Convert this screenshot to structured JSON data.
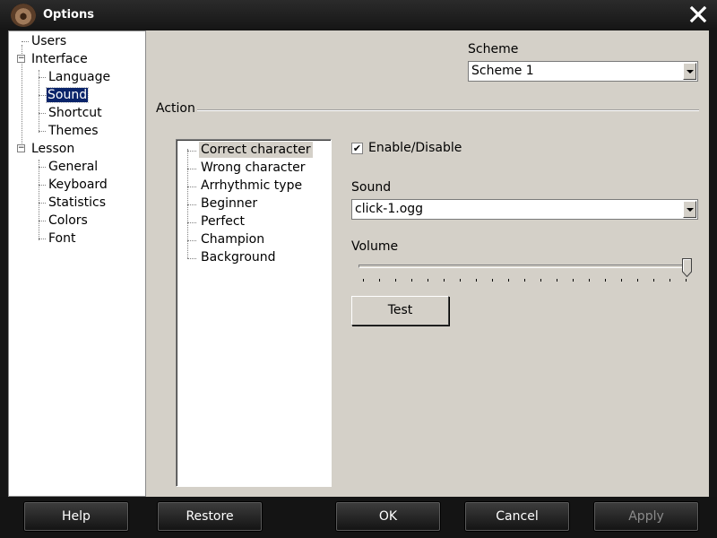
{
  "window": {
    "title": "Options"
  },
  "tree": [
    {
      "label": "Users"
    },
    {
      "label": "Interface"
    },
    {
      "label": "Language"
    },
    {
      "label": "Sound",
      "selected": true
    },
    {
      "label": "Shortcut"
    },
    {
      "label": "Themes"
    },
    {
      "label": "Lesson"
    },
    {
      "label": "General"
    },
    {
      "label": "Keyboard"
    },
    {
      "label": "Statistics"
    },
    {
      "label": "Colors"
    },
    {
      "label": "Font"
    }
  ],
  "scheme": {
    "label": "Scheme",
    "value": "Scheme 1"
  },
  "action": {
    "label": "Action",
    "items": [
      "Correct character",
      "Wrong character",
      "Arrhythmic type",
      "Beginner",
      "Perfect",
      "Champion",
      "Background"
    ],
    "selected_index": 0
  },
  "enable": {
    "label": "Enable/Disable",
    "checked": true
  },
  "sound": {
    "label": "Sound",
    "value": "click-1.ogg"
  },
  "volume": {
    "label": "Volume",
    "level": 1.0
  },
  "test_button": "Test",
  "footer": {
    "help": "Help",
    "restore": "Restore",
    "ok": "OK",
    "cancel": "Cancel",
    "apply": "Apply"
  }
}
